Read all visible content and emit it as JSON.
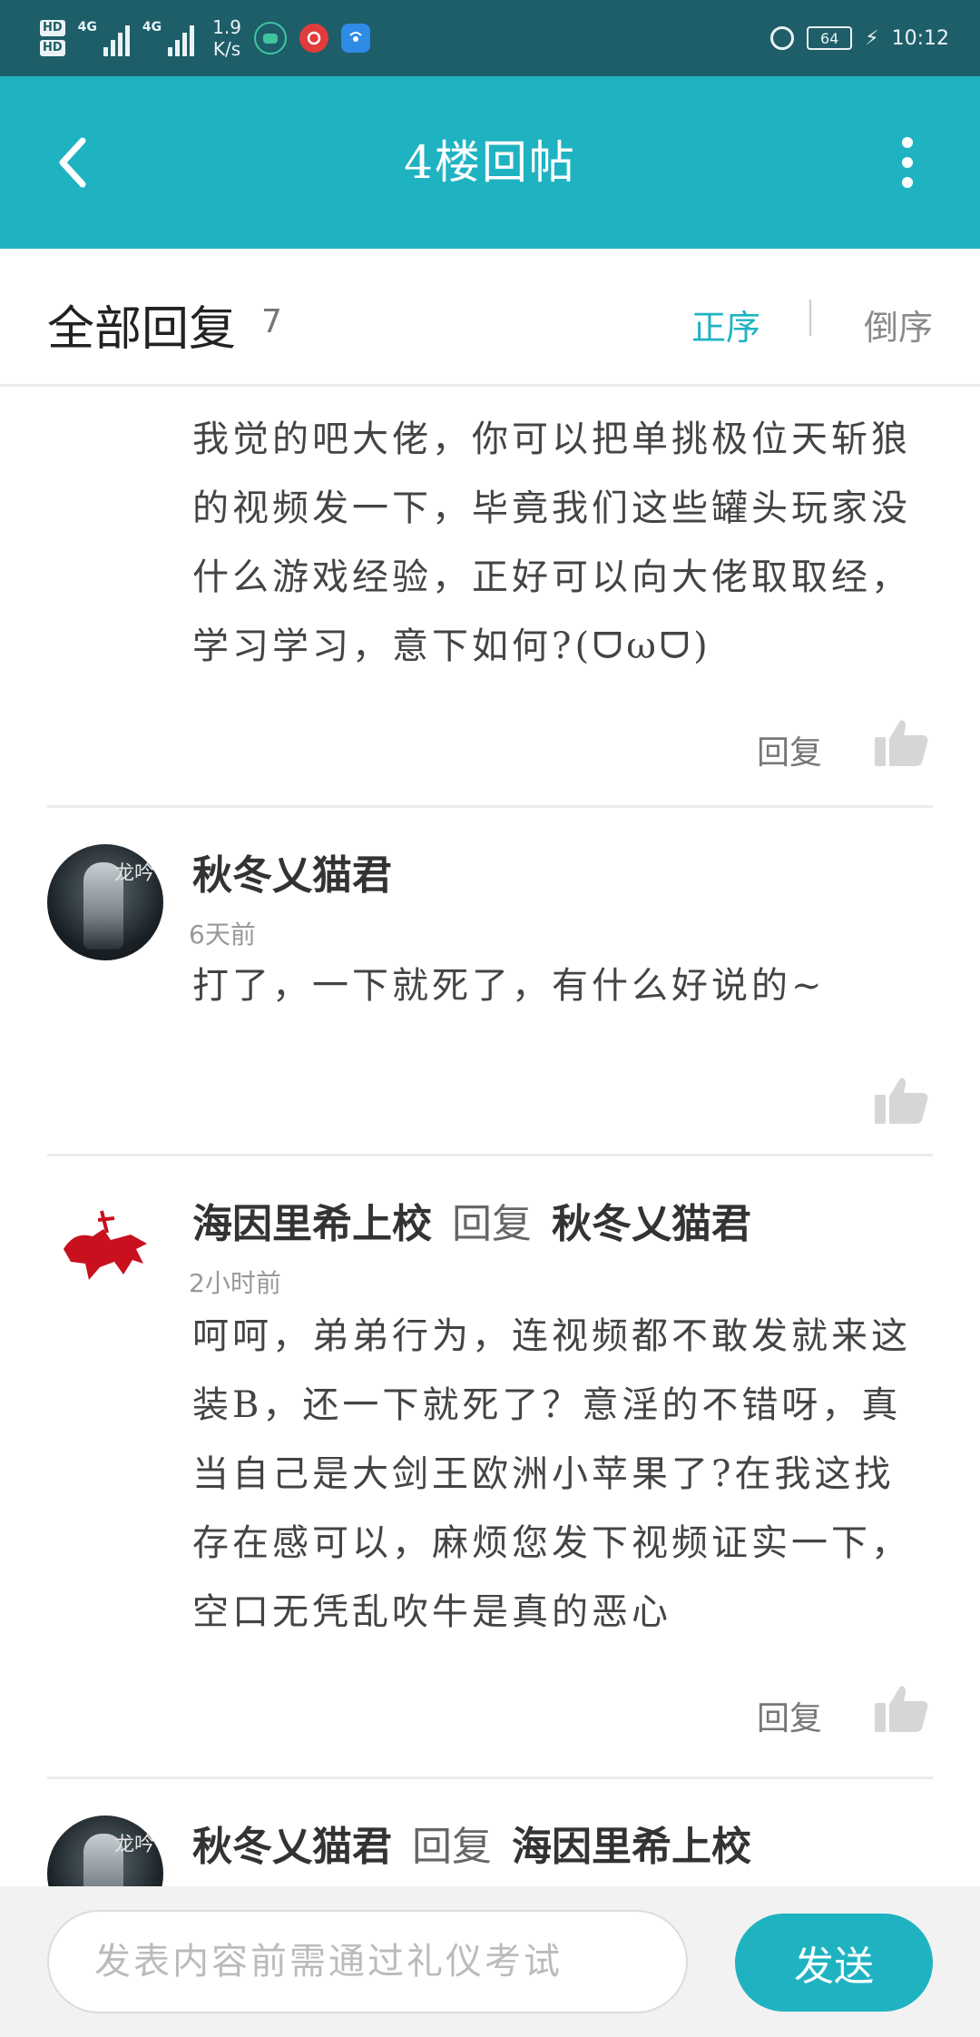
{
  "status_bar": {
    "hd1": "HD",
    "hd2": "HD",
    "net1": "4G",
    "net2": "4G",
    "speed_value": "1.9",
    "speed_unit": "K/s",
    "battery": "64",
    "time": "10:12"
  },
  "header": {
    "title": "4楼回帖"
  },
  "reply_bar": {
    "title": "全部回复",
    "count": "7",
    "sort_asc": "正序",
    "sort_desc": "倒序"
  },
  "posts": [
    {
      "text": "我觉的吧大佬，你可以把单挑极位天斩狼的视频发一下，毕竟我们这些罐头玩家没什么游戏经验，正好可以向大佬取取经，学习学习，意下如何?(ᗜωᗜ)",
      "reply_label": "回复"
    },
    {
      "author": "秋冬乂猫君",
      "time": "6天前",
      "text": "打了，一下就死了，有什么好说的~",
      "avatar_text": "龙吟"
    },
    {
      "author": "海因里希上校",
      "verb": "回复",
      "target": "秋冬乂猫君",
      "time": "2小时前",
      "text": "呵呵，弟弟行为，连视频都不敢发就来这装B，还一下就死了？意淫的不错呀，真当自己是大剑王欧洲小苹果了?在我这找存在感可以，麻烦您发下视频证实一下，空口无凭乱吹牛是真的恶心",
      "reply_label": "回复"
    },
    {
      "author": "秋冬乂猫君",
      "verb": "回复",
      "target": "海因里希上校",
      "avatar_text": "龙吟"
    }
  ],
  "input": {
    "placeholder": "发表内容前需通过礼仪考试",
    "send_label": "发送"
  },
  "colors": {
    "status_bar": "#1e5e69",
    "header": "#1fb3c2",
    "accent": "#1fb3c2"
  }
}
